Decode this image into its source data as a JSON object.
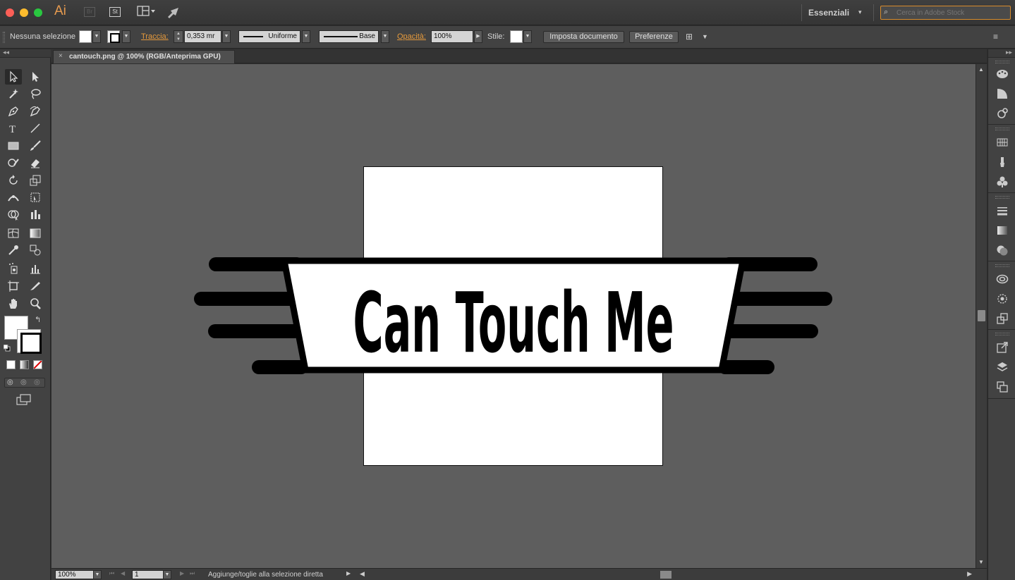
{
  "titlebar": {
    "app_logo": "Ai",
    "bridge_label": "Br",
    "stock_label": "St",
    "workspace": "Essenziali",
    "stock_search_placeholder": "Cerca in Adobe Stock"
  },
  "controlbar": {
    "selection_label": "Nessuna selezione",
    "stroke_label": "Traccia:",
    "stroke_weight": "0,353 mr",
    "stroke_profile": "Uniforme",
    "brush_label": "Base",
    "opacity_label": "Opacità:",
    "opacity_value": "100%",
    "style_label": "Stile:",
    "document_setup_button": "Imposta documento",
    "preferences_button": "Preferenze"
  },
  "document_tab": {
    "close_glyph": "×",
    "title": "cantouch.png @ 100% (RGB/Anteprima GPU)"
  },
  "artwork": {
    "text": "Can Touch Me"
  },
  "statusbar": {
    "zoom": "100%",
    "artboard_number": "1",
    "status_message": "Aggiunge/toglie alla selezione diretta"
  },
  "colors": {
    "accent_orange": "#e69a3c",
    "canvas_bg": "#5e5e5e",
    "panel_bg": "#424242",
    "artboard": "#ffffff",
    "logo_ink": "#000000"
  },
  "tools": [
    "selection-tool",
    "direct-selection-tool",
    "magic-wand-tool",
    "lasso-tool",
    "pen-tool",
    "curvature-tool",
    "type-tool",
    "line-segment-tool",
    "rectangle-tool",
    "paintbrush-tool",
    "shaper-tool",
    "eraser-tool",
    "rotate-tool",
    "scale-tool",
    "width-tool",
    "free-transform-tool",
    "shape-builder-tool",
    "graph-tool",
    "mesh-tool",
    "gradient-tool",
    "eyedropper-tool",
    "blend-tool",
    "symbol-sprayer-tool",
    "column-graph-tool",
    "artboard-tool",
    "slice-tool",
    "hand-tool",
    "zoom-tool"
  ],
  "right_dock_icons": [
    "color-panel-icon",
    "color-guide-icon",
    "appearance-icon",
    "swatches-icon",
    "brushes-icon",
    "symbols-icon",
    "stroke-icon",
    "gradient-icon",
    "transparency-icon",
    "cc-libraries-icon",
    "image-trace-icon",
    "asset-export-icon",
    "export-icon",
    "layers-icon",
    "artboards-icon"
  ]
}
